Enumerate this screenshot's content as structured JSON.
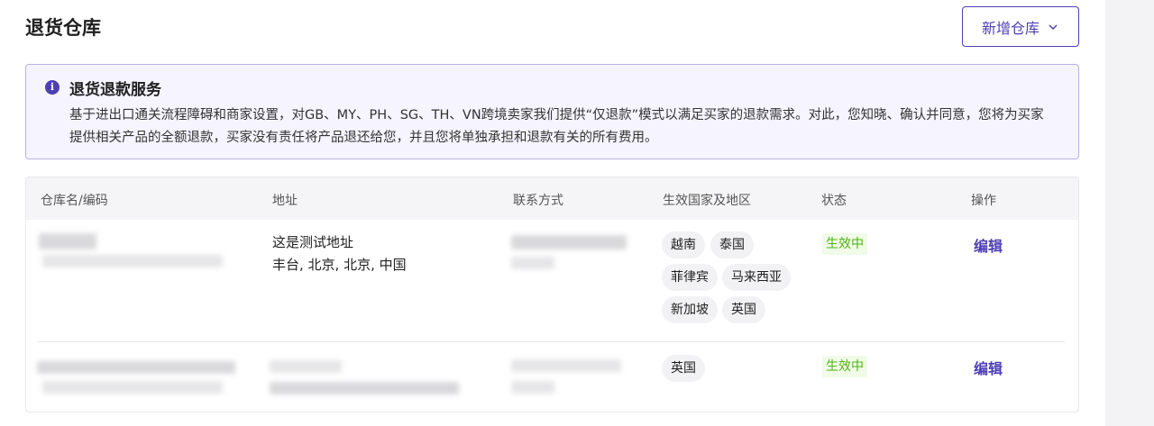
{
  "header": {
    "title": "退货仓库",
    "add_button_label": "新增仓库"
  },
  "notice": {
    "title": "退货退款服务",
    "body": "基于进出口通关流程障碍和商家设置，对GB、MY、PH、SG、TH、VN跨境卖家我们提供“仅退款”模式以满足买家的退款需求。对此，您知晓、确认并同意，您将为买家提供相关产品的全额退款，买家没有责任将产品退还给您，并且您将单独承担和退款有关的所有费用。",
    "icon": "info-icon"
  },
  "table": {
    "columns": [
      "仓库名/编码",
      "地址",
      "联系方式",
      "生效国家及地区",
      "状态",
      "操作"
    ],
    "rows": [
      {
        "address_line1": "这是测试地址",
        "address_line2": "丰台, 北京, 北京, 中国",
        "regions": [
          "越南",
          "泰国",
          "菲律宾",
          "马来西亚",
          "新加坡",
          "英国"
        ],
        "status": "生效中",
        "action": "编辑"
      },
      {
        "regions": [
          "英国"
        ],
        "status": "生效中",
        "action": "编辑"
      }
    ]
  },
  "colors": {
    "accent": "#4d3fb3",
    "status_green": "#52b212",
    "notice_bg": "#f5f4ff"
  }
}
